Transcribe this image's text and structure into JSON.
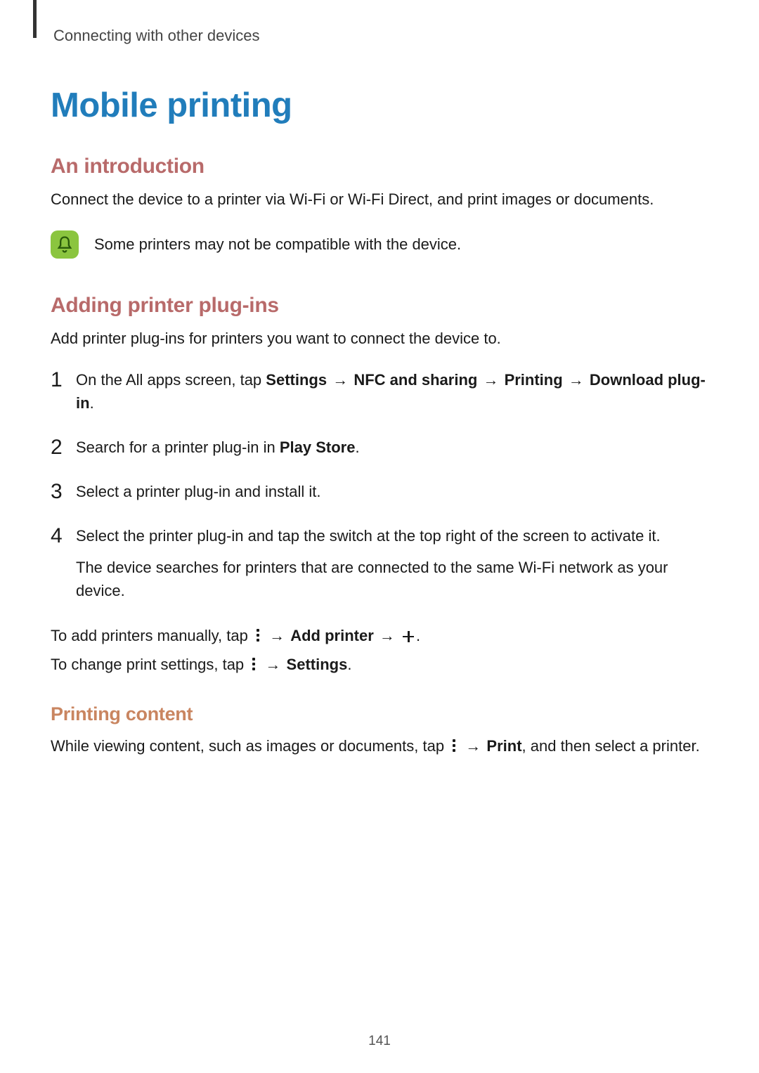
{
  "breadcrumb": "Connecting with other devices",
  "title": "Mobile printing",
  "intro": {
    "heading": "An introduction",
    "text": "Connect the device to a printer via Wi-Fi or Wi-Fi Direct, and print images or documents.",
    "note": "Some printers may not be compatible with the device."
  },
  "plugins": {
    "heading": "Adding printer plug-ins",
    "lead": "Add printer plug-ins for printers you want to connect the device to.",
    "step1_a": "On the All apps screen, tap ",
    "step1_settings": "Settings",
    "step1_arrow": " → ",
    "step1_nfc": "NFC and sharing",
    "step1_printing": "Printing",
    "step1_download": "Download plug-in",
    "step1_period": ".",
    "step2_a": "Search for a printer plug-in in ",
    "step2_b": "Play Store",
    "step2_c": ".",
    "step3": "Select a printer plug-in and install it.",
    "step4_a": "Select the printer plug-in and tap the switch at the top right of the screen to activate it.",
    "step4_b": "The device searches for printers that are connected to the same Wi-Fi network as your device.",
    "manual_a": "To add printers manually, tap ",
    "manual_arrow": " → ",
    "manual_add": "Add printer",
    "manual_period": ".",
    "settings_a": "To change print settings, tap ",
    "settings_arrow": " → ",
    "settings_b": "Settings",
    "settings_c": "."
  },
  "printing": {
    "heading": "Printing content",
    "text_a": "While viewing content, such as images or documents, tap ",
    "text_arrow": " → ",
    "text_print": "Print",
    "text_b": ", and then select a printer."
  },
  "page_number": "141"
}
